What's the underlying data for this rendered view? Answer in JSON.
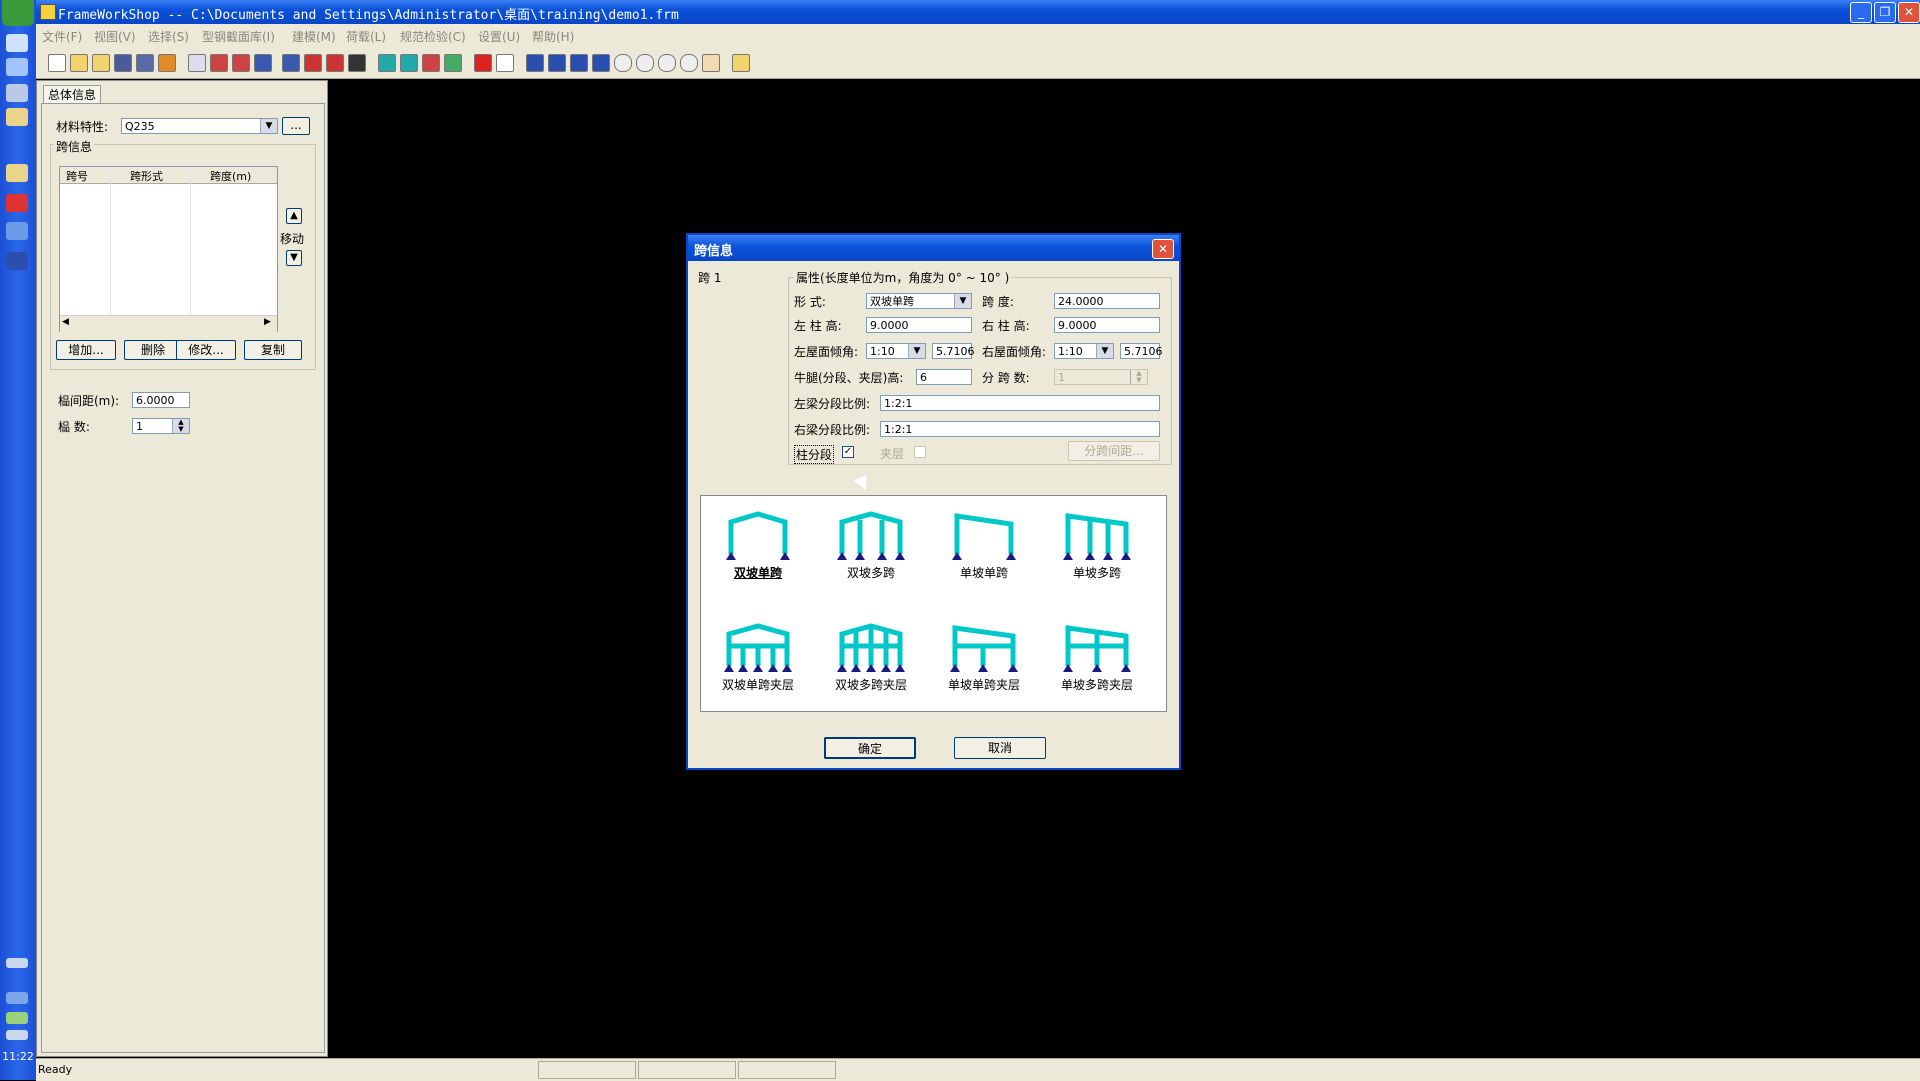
{
  "window": {
    "title": "FrameWorkShop -- C:\\Documents and Settings\\Administrator\\桌面\\training\\demo1.frm"
  },
  "menu": [
    "文件(F)",
    "视图(V)",
    "选择(S)",
    "型钢截面库(I)",
    "建模(M)",
    "荷载(L)",
    "规范检验(C)",
    "设置(U)",
    "帮助(H)"
  ],
  "taskbar": {
    "clock": "11:22"
  },
  "left_panel": {
    "tab": "总体信息",
    "material_label": "材料特性:",
    "material_value": "Q235",
    "material_browse": "...",
    "span_group_label": "跨信息",
    "table_headers": [
      "跨号",
      "跨形式",
      "跨度(m)"
    ],
    "move_label": "移动",
    "buttons": {
      "add": "增加...",
      "delete": "删除",
      "modify": "修改...",
      "copy": "复制"
    },
    "bay_spacing_label": "榀间距(m):",
    "bay_spacing_value": "6.0000",
    "bay_count_label": "榀    数:",
    "bay_count_value": "1"
  },
  "status": {
    "text": "Ready"
  },
  "dialog": {
    "title": "跨信息",
    "span_label": "跨  1",
    "group_label": "属性(长度单位为m，角度为 0° ~  10° )",
    "form_label": "形    式:",
    "form_value": "双坡单跨",
    "span_len_label": "跨      度:",
    "span_len_value": "24.0000",
    "left_col_label": "左  柱  高:",
    "left_col_value": "9.0000",
    "right_col_label": "右  柱  高:",
    "right_col_value": "9.0000",
    "left_roof_label": "左屋面倾角:",
    "left_roof_ratio": "1:10",
    "left_roof_angle": "5.7106",
    "right_roof_label": "右屋面倾角:",
    "right_roof_ratio": "1:10",
    "right_roof_angle": "5.7106",
    "corbel_label": "牛腿(分段、夹层)高:",
    "corbel_value": "6",
    "sub_span_label": "分  跨  数:",
    "sub_span_value": "1",
    "left_beam_label": "左梁分段比例:",
    "left_beam_value": "1:2:1",
    "right_beam_label": "右梁分段比例:",
    "right_beam_value": "1:2:1",
    "column_seg_label": "柱分段",
    "column_seg_checked": "✓",
    "mezzanine_label": "夹层",
    "sub_span_spacing_button": "分跨间距...",
    "frame_types": [
      "双坡单跨",
      "双坡多跨",
      "单坡单跨",
      "单坡多跨",
      "双坡单跨夹层",
      "双坡多跨夹层",
      "单坡单跨夹层",
      "单坡多跨夹层"
    ],
    "selected_type": "双坡单跨",
    "ok": "确定",
    "cancel": "取消"
  },
  "colors": {
    "frame": "#00c8c8",
    "support": "#1a1a80",
    "title_blue": "#0a46c8"
  }
}
